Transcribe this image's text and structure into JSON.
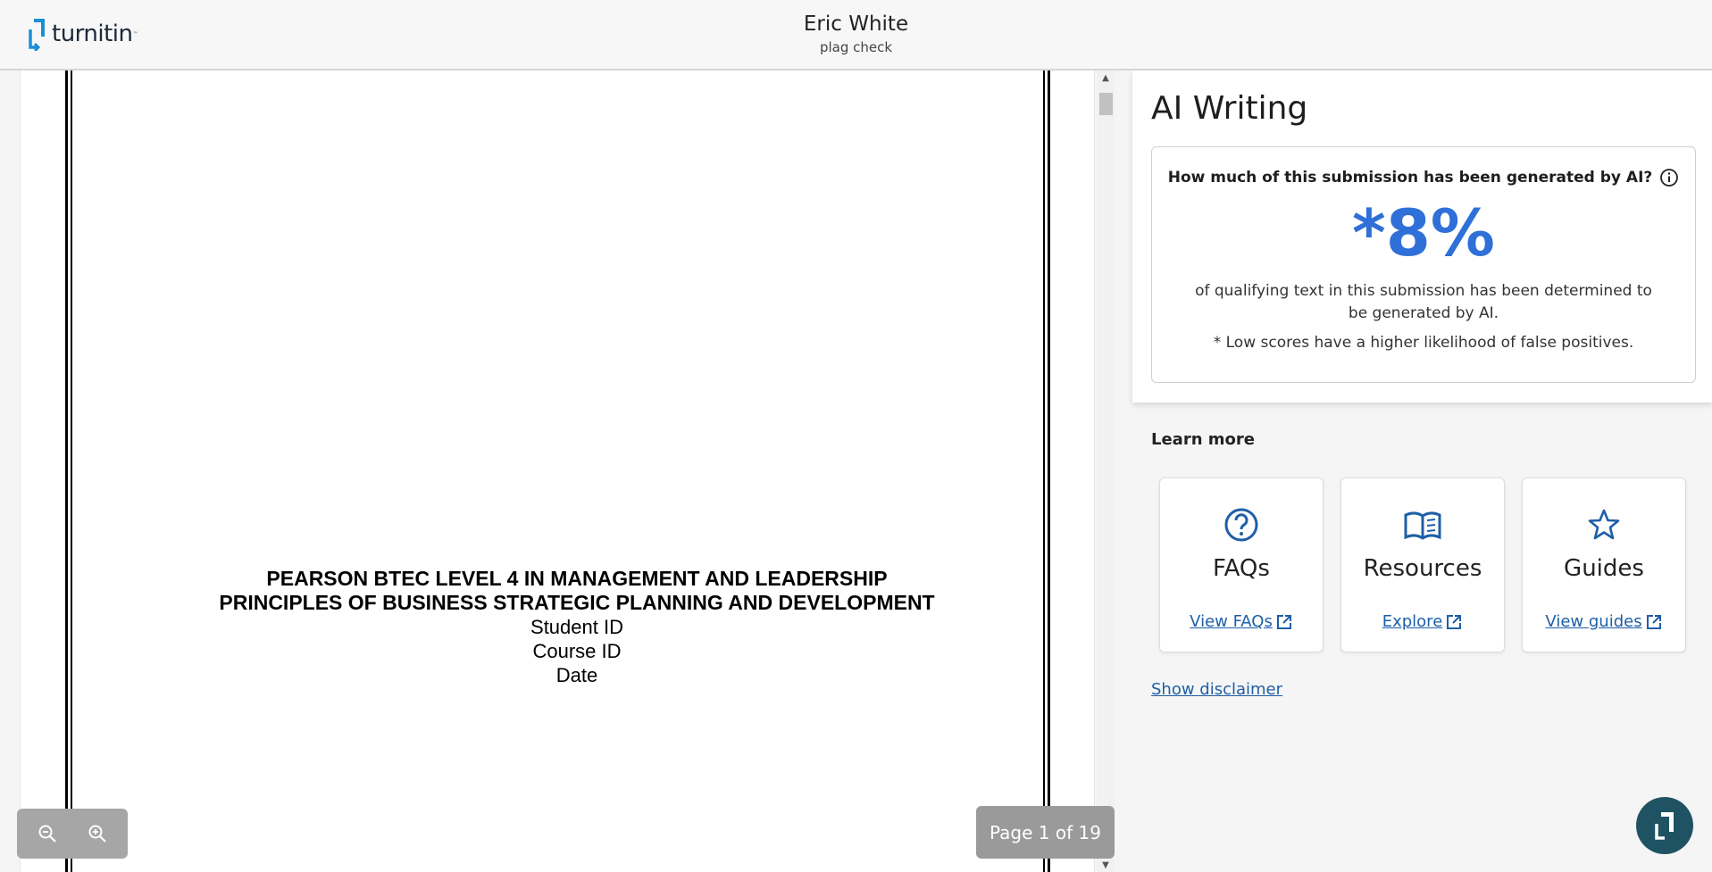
{
  "header": {
    "logo_text": "turnitin",
    "student_name": "Eric White",
    "assignment_title": "plag check"
  },
  "document": {
    "title_line_1": "PEARSON BTEC LEVEL 4 IN MANAGEMENT AND LEADERSHIP",
    "title_line_2": "PRINCIPLES OF BUSINESS STRATEGIC PLANNING AND DEVELOPMENT",
    "line_student_id": "Student ID",
    "line_course_id": "Course ID",
    "line_date": "Date"
  },
  "viewer": {
    "page_indicator": "Page 1 of 19",
    "zoom_out_icon": "zoom-out-icon",
    "zoom_in_icon": "zoom-in-icon"
  },
  "ai_panel": {
    "title": "AI Writing",
    "question": "How much of this submission has been generated by AI?",
    "percentage": "*8%",
    "description": "of qualifying text in this submission has been determined to be generated by AI.",
    "note": "* Low scores have a higher likelihood of false positives."
  },
  "learn_more": {
    "title": "Learn more",
    "cards": [
      {
        "label": "FAQs",
        "link": "View FAQs",
        "icon": "question-circle-icon"
      },
      {
        "label": "Resources",
        "link": "Explore",
        "icon": "open-book-icon"
      },
      {
        "label": "Guides",
        "link": "View guides",
        "icon": "star-icon"
      }
    ],
    "disclaimer_link": "Show disclaimer"
  },
  "colors": {
    "accent_blue": "#2f6fd8",
    "link_blue": "#1e5fa8",
    "help_button": "#1f5263"
  }
}
